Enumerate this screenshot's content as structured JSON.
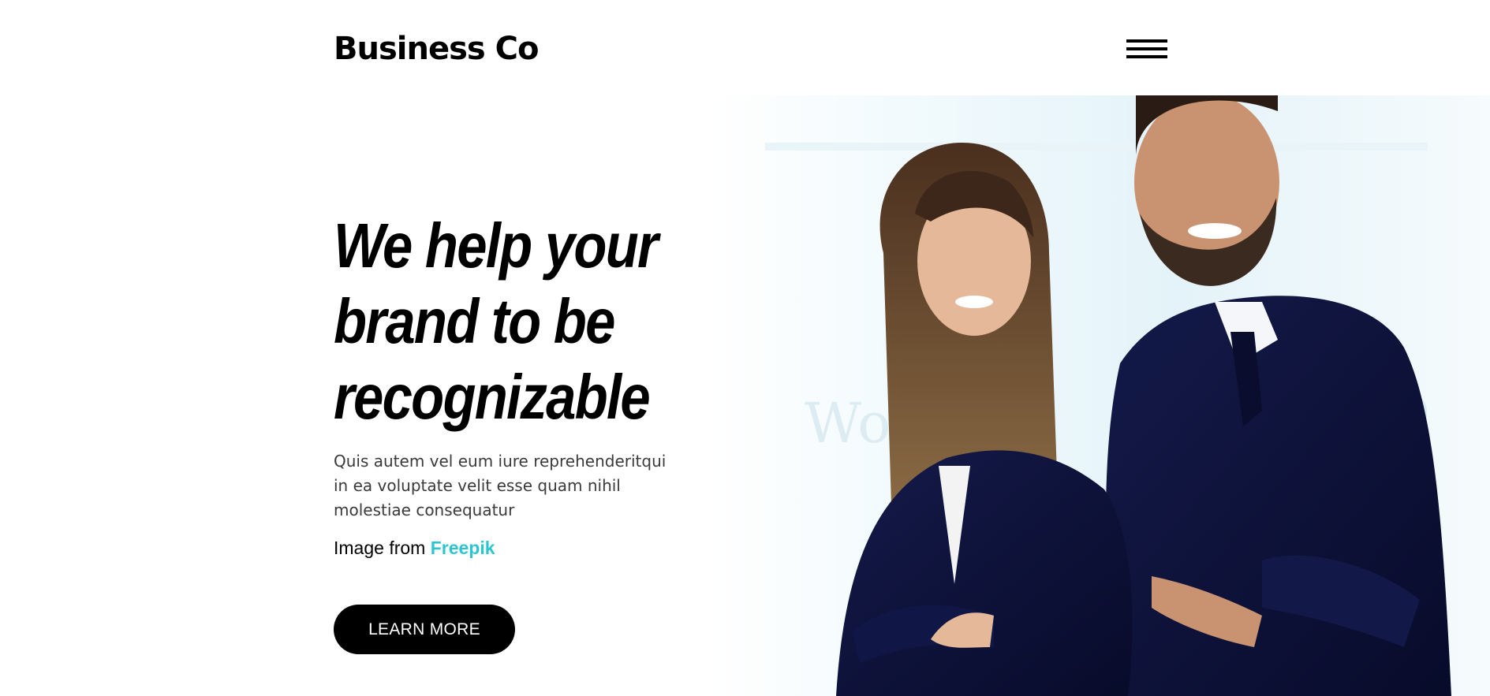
{
  "header": {
    "brand": "Business Co",
    "menu_icon": "hamburger-menu-icon"
  },
  "hero": {
    "headline": "We help your brand to be recognizable",
    "lead": "Quis autem vel eum iure reprehenderitqui in ea voluptate velit esse quam nihil molestiae consequatur",
    "credit_prefix": "Image from",
    "credit_link": "Freepik",
    "cta_label": "LEARN MORE",
    "image_alt": "two business people standing back to back"
  },
  "colors": {
    "accent": "#2ec5d3",
    "text": "#000000",
    "muted": "#3a3a3a",
    "suit": "#0f1540"
  }
}
